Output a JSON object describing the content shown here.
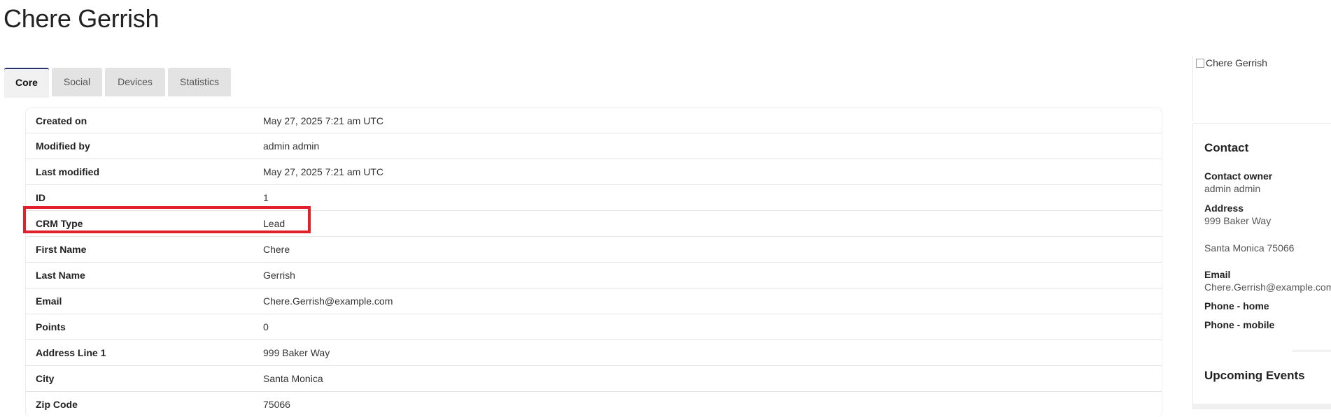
{
  "page": {
    "title": "Chere Gerrish"
  },
  "tabs": [
    {
      "label": "Core",
      "active": true
    },
    {
      "label": "Social",
      "active": false
    },
    {
      "label": "Devices",
      "active": false
    },
    {
      "label": "Statistics",
      "active": false
    }
  ],
  "details": [
    {
      "label": "Created on",
      "value": "May 27, 2025 7:21 am UTC"
    },
    {
      "label": "Modified by",
      "value": "admin admin"
    },
    {
      "label": "Last modified",
      "value": "May 27, 2025 7:21 am UTC"
    },
    {
      "label": "ID",
      "value": "1"
    },
    {
      "label": "CRM Type",
      "value": "Lead"
    },
    {
      "label": "First Name",
      "value": "Chere"
    },
    {
      "label": "Last Name",
      "value": "Gerrish"
    },
    {
      "label": "Email",
      "value": "Chere.Gerrish@example.com"
    },
    {
      "label": "Points",
      "value": "0"
    },
    {
      "label": "Address Line 1",
      "value": "999 Baker Way"
    },
    {
      "label": "City",
      "value": "Santa Monica"
    },
    {
      "label": "Zip Code",
      "value": "75066"
    }
  ],
  "sidebar": {
    "avatar_alt": "Chere Gerrish",
    "contact": {
      "title": "Contact",
      "owner_label": "Contact owner",
      "owner_value": "admin admin",
      "address_label": "Address",
      "address_line1": "999 Baker Way",
      "address_line2": "Santa Monica 75066",
      "email_label": "Email",
      "email_value": "Chere.Gerrish@example.com",
      "phone_home_label": "Phone - home",
      "phone_mobile_label": "Phone - mobile"
    },
    "events_title": "Upcoming Events"
  },
  "colors": {
    "highlight": "#e0202a",
    "active_tab_accent": "#27336e",
    "tab_bg": "#e3e3e3"
  }
}
